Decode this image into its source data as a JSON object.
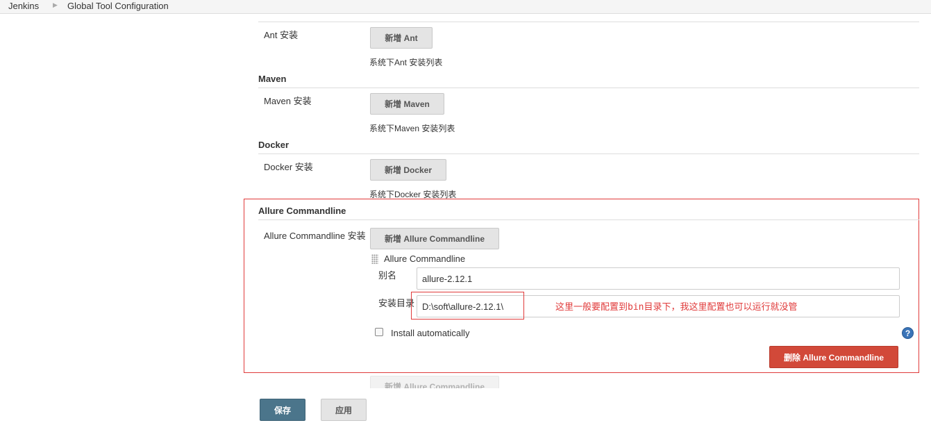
{
  "breadcrumb": {
    "root": "Jenkins",
    "current": "Global Tool Configuration"
  },
  "sections": {
    "ant": {
      "install_label": "Ant 安装",
      "add_button": "新增 Ant",
      "description": "系统下Ant 安装列表"
    },
    "maven": {
      "title": "Maven",
      "install_label": "Maven 安装",
      "add_button": "新增 Maven",
      "description": "系统下Maven 安装列表"
    },
    "docker": {
      "title": "Docker",
      "install_label": "Docker 安装",
      "add_button": "新增 Docker",
      "description": "系统下Docker 安装列表"
    },
    "allure": {
      "title": "Allure Commandline",
      "install_label": "Allure Commandline 安装",
      "add_button": "新增 Allure Commandline",
      "item_title": "Allure Commandline",
      "name_label": "别名",
      "name_value": "allure-2.12.1",
      "home_label": "安装目录",
      "home_value": "D:\\soft\\allure-2.12.1\\",
      "annotation": "这里一般要配置到bin目录下，我这里配置也可以运行就没管",
      "install_auto_label": "Install automatically",
      "install_auto_checked": false,
      "delete_button": "删除 Allure Commandline",
      "help_icon": "help-icon"
    }
  },
  "footer": {
    "save_button": "保存",
    "apply_button": "应用"
  },
  "colors": {
    "annotation_red": "#e03a3a",
    "save_blue": "#4b758b",
    "delete_red": "#d24939"
  }
}
